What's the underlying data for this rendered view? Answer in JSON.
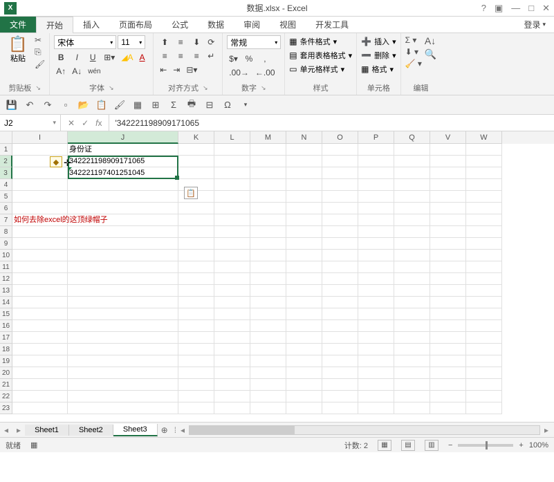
{
  "title": "数据.xlsx - Excel",
  "login": "登录",
  "tabs": {
    "file": "文件",
    "home": "开始",
    "insert": "插入",
    "layout": "页面布局",
    "formulas": "公式",
    "data": "数据",
    "review": "审阅",
    "view": "视图",
    "dev": "开发工具"
  },
  "ribbon": {
    "clipboard": {
      "paste": "粘贴",
      "label": "剪贴板"
    },
    "font": {
      "name": "宋体",
      "size": "11",
      "label": "字体"
    },
    "alignment": {
      "label": "对齐方式"
    },
    "number": {
      "format": "常规",
      "label": "数字"
    },
    "styles": {
      "cond": "条件格式",
      "table": "套用表格格式",
      "cell": "单元格样式",
      "label": "样式"
    },
    "cells": {
      "insert": "插入",
      "delete": "删除",
      "format": "格式",
      "label": "单元格"
    },
    "editing": {
      "label": "编辑"
    }
  },
  "namebox": "J2",
  "formula": "'342221198909171065",
  "columns": [
    "I",
    "J",
    "K",
    "L",
    "M",
    "N",
    "O",
    "P",
    "Q",
    "V",
    "W"
  ],
  "data_cells": {
    "J1": "身份证",
    "J2": "342221198909171065",
    "J3": "342221197401251045",
    "I7": "如何去除excel的这顶绿帽子"
  },
  "sheets": [
    "Sheet1",
    "Sheet2",
    "Sheet3"
  ],
  "active_sheet": "Sheet3",
  "status": {
    "ready": "就绪",
    "count_label": "计数:",
    "count": "2",
    "zoom": "100%"
  }
}
